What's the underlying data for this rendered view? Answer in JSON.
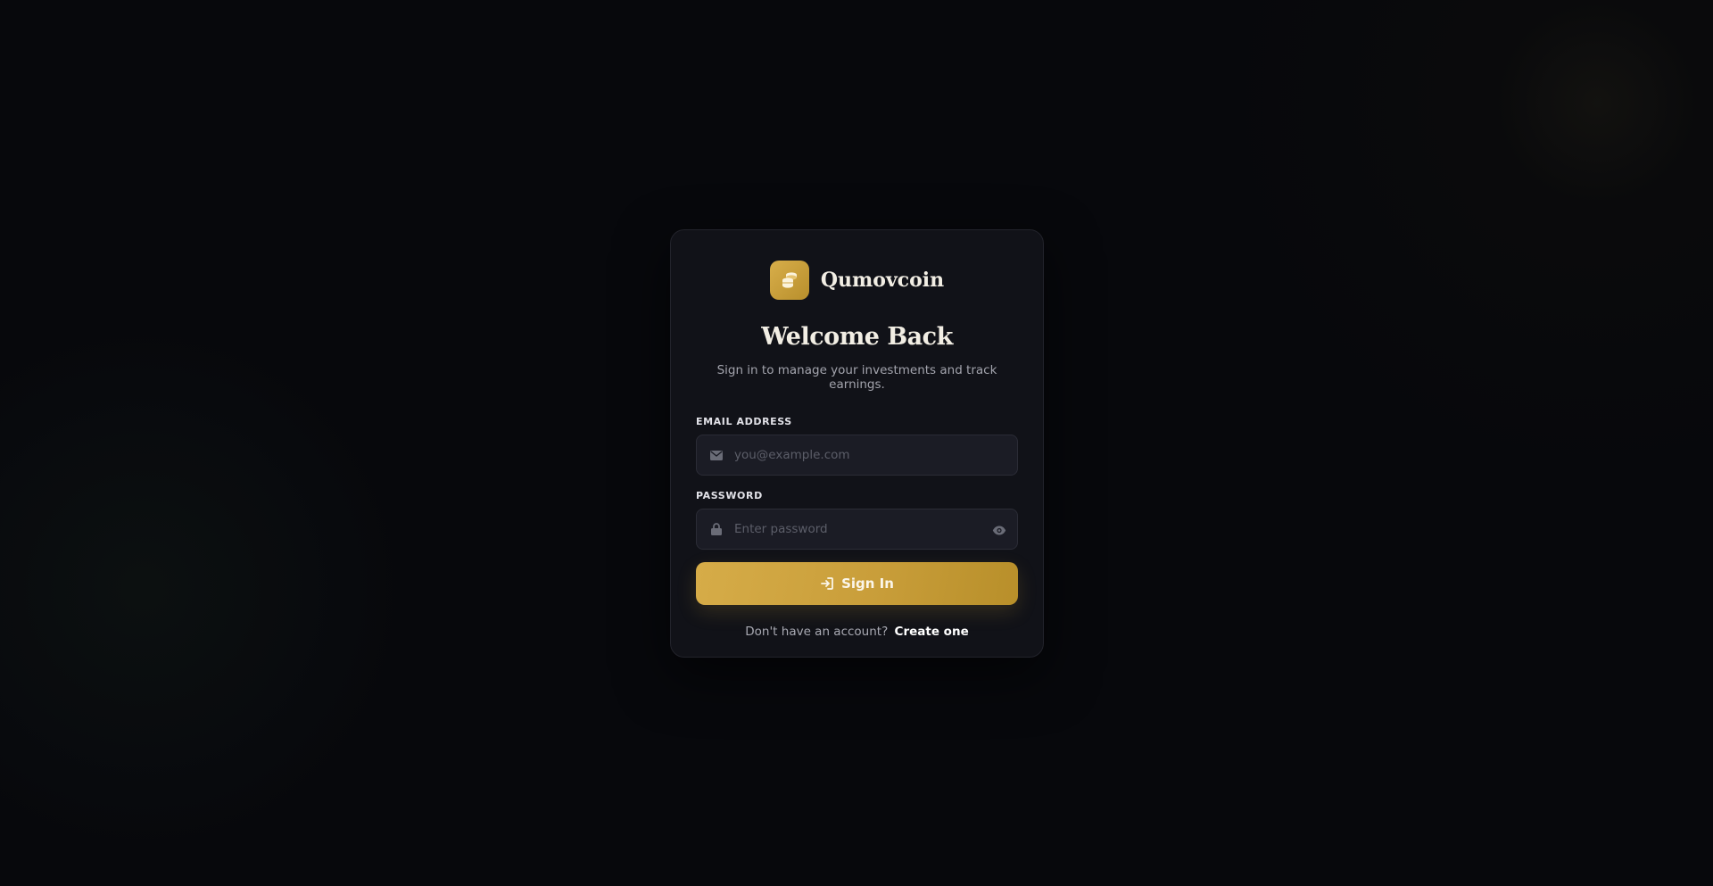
{
  "brand": {
    "name": "Qumovcoin",
    "logo_icon": "coins-stack-icon"
  },
  "heading": {
    "title": "Welcome Back",
    "subtitle": "Sign in to manage your investments and track earnings."
  },
  "form": {
    "email": {
      "label": "EMAIL ADDRESS",
      "placeholder": "you@example.com",
      "value": "",
      "icon": "envelope-icon"
    },
    "password": {
      "label": "PASSWORD",
      "placeholder": "Enter password",
      "value": "",
      "icon": "lock-icon",
      "toggle_icon": "eye-icon"
    },
    "submit": {
      "label": "Sign In",
      "icon": "sign-in-icon"
    }
  },
  "footer": {
    "prompt": "Don't have an account?",
    "link": "Create one"
  },
  "colors": {
    "accent": "#c99e3a",
    "background": "#07080c",
    "card": "#111218"
  }
}
